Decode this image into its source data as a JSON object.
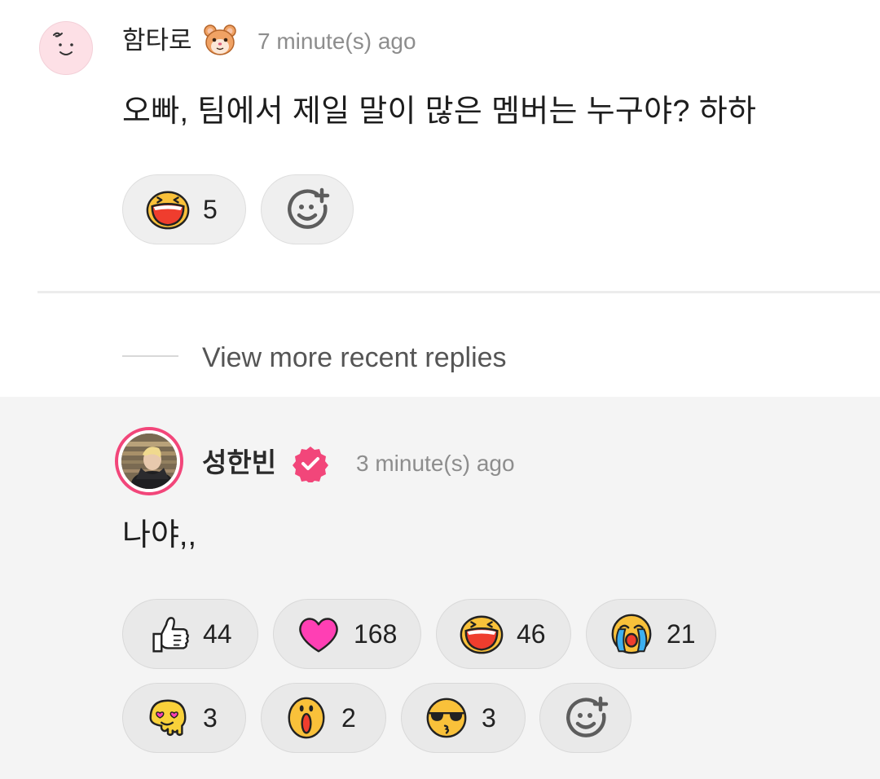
{
  "comment": {
    "author": "함타로",
    "author_emoji_icon": "hamster-face-icon",
    "time": "7 minute(s) ago",
    "text": "오빠, 팀에서 제일 말이 많은 멤버는 누구야? 하하",
    "reactions": [
      {
        "icon": "laughing-face-icon",
        "count": "5"
      }
    ]
  },
  "view_more": {
    "label": "View more recent replies"
  },
  "reply": {
    "author": "성한빈",
    "verified_icon": "verified-badge-icon",
    "time": "3 minute(s) ago",
    "text": "나야,,",
    "reactions": [
      {
        "icon": "thumbs-up-icon",
        "count": "44"
      },
      {
        "icon": "heart-icon",
        "count": "168"
      },
      {
        "icon": "laughing-face-icon",
        "count": "46"
      },
      {
        "icon": "crying-face-icon",
        "count": "21"
      },
      {
        "icon": "heart-eyes-face-icon",
        "count": "3"
      },
      {
        "icon": "surprised-face-icon",
        "count": "2"
      },
      {
        "icon": "sunglasses-kiss-face-icon",
        "count": "3"
      }
    ]
  },
  "colors": {
    "accent_pink": "#f2467a",
    "pill_bg": "#efefef",
    "meta_text": "#8d8d8d"
  }
}
